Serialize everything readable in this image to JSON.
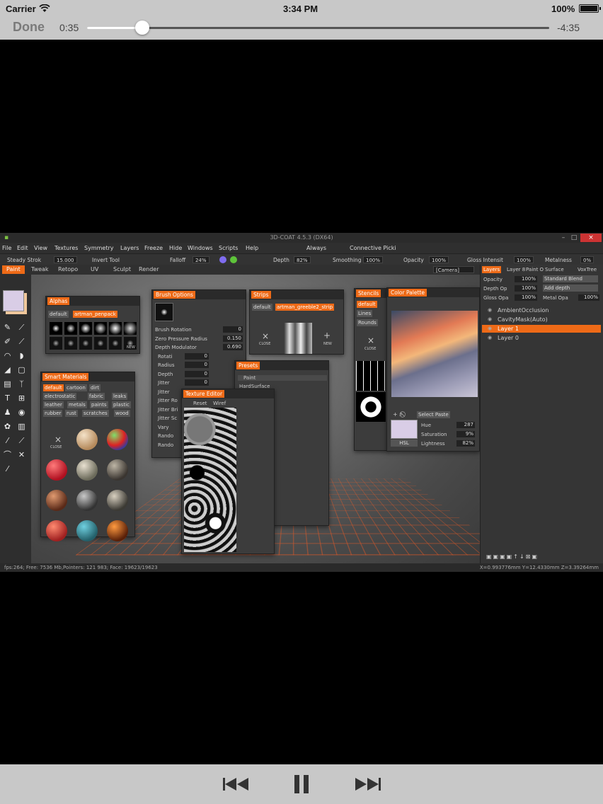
{
  "status_bar": {
    "carrier": "Carrier",
    "time": "3:34 PM",
    "battery": "100%"
  },
  "player": {
    "done_label": "Done",
    "elapsed": "0:35",
    "remaining": "-4:35",
    "progress_fraction": 0.12
  },
  "app": {
    "window_title": "3D-COAT 4.5.3 (DX64)",
    "menu": [
      "File",
      "Edit",
      "View",
      "Textures",
      "Symmetry",
      "Layers",
      "Freeze",
      "Hide",
      "Windows",
      "Scripts",
      "Help"
    ],
    "menu_extra": [
      "Always",
      "Connective Picki"
    ],
    "toolbar": {
      "steady_stroke": "Steady Strok",
      "steady_value": "15.000",
      "invert_tool": "Invert Tool",
      "falloff": "Falloff",
      "falloff_value": "24%",
      "depth": "Depth",
      "depth_value": "82%",
      "smoothing": "Smoothing",
      "smoothing_value": "100%",
      "opacity": "Opacity",
      "opacity_value": "100%",
      "gloss": "Gloss Intensit",
      "gloss_value": "100%",
      "metalness": "Metalness",
      "metalness_value": "0%"
    },
    "rooms": [
      "Paint",
      "Tweak",
      "Retopo",
      "UV",
      "Sculpt",
      "Render"
    ],
    "camera_label": "[Camera]",
    "alphas": {
      "title": "Alphas",
      "tabs": [
        "default",
        "artman_penpack"
      ],
      "new_label": "NEW"
    },
    "brush_options": {
      "title": "Brush Options",
      "rows": [
        {
          "label": "Brush Rotation",
          "value": "0"
        },
        {
          "label": "Zero Pressure Radius",
          "value": "0.150"
        },
        {
          "label": "Depth Modulator",
          "value": "0.690"
        },
        {
          "label": "Rotati",
          "value": "0"
        },
        {
          "label": "Radius",
          "value": "0"
        },
        {
          "label": "Depth",
          "value": "0"
        },
        {
          "label": "Jitter",
          "value": "0"
        },
        {
          "label": "Jitter",
          "value": ""
        },
        {
          "label": "Jitter Ro",
          "value": ""
        },
        {
          "label": "Jitter Bri",
          "value": ""
        },
        {
          "label": "Jitter Sc",
          "value": ""
        },
        {
          "label": "Vary",
          "value": ""
        },
        {
          "label": "Rando",
          "value": ""
        },
        {
          "label": "Rando",
          "value": ""
        }
      ]
    },
    "strips": {
      "title": "Strips",
      "tabs": [
        "default",
        "artman_greeble2_strip"
      ],
      "close_label": "CLOSE",
      "new_label": "NEW"
    },
    "stencils": {
      "title": "Stencils",
      "tabs": [
        "default"
      ],
      "buttons": [
        "Lines",
        "Rounds"
      ],
      "close_label": "CLOSE"
    },
    "presets": {
      "title": "Presets",
      "items": [
        "Paint",
        "HardSurface"
      ]
    },
    "texture_editor": {
      "title": "Texture Editor",
      "buttons": [
        "Reset",
        "Wiref"
      ]
    },
    "smart_materials": {
      "title": "Smart Materials",
      "tags": [
        "default",
        "cartoon",
        "dirt",
        "electrostatic",
        "fabric",
        "leaks",
        "leather",
        "metals",
        "paints",
        "plastic",
        "rubber",
        "rust",
        "scratches",
        "wood"
      ],
      "close_label": "CLOSE"
    },
    "color_palette": {
      "title": "Color Palette",
      "select_paste": "Select Paste",
      "hsl_label": "HSL",
      "hue_label": "Hue",
      "hue_value": "287",
      "saturation_label": "Saturation",
      "saturation_value": "9%",
      "lightness_label": "Lightness",
      "lightness_value": "82%",
      "current_color": "#d9cde6"
    },
    "layers": {
      "tabs": [
        "Layers",
        "Layer 8",
        "Paint O",
        "Surface",
        "VoxTree"
      ],
      "opacity_label": "Opacity",
      "opacity_value": "100%",
      "blend_mode": "Standard Blend",
      "depth_op_label": "Depth Op",
      "depth_op_value": "100%",
      "depth_mode": "Add depth",
      "gloss_op_label": "Gloss Opa",
      "gloss_op_value": "100%",
      "metal_op_label": "Metal Opa",
      "metal_op_value": "100%",
      "items": [
        "AmbientOcclusion",
        "CavityMask(Auto)",
        "Layer 1",
        "Layer 0"
      ],
      "selected_index": 2
    },
    "status": {
      "left": "fps:264;   Free: 7536 Mb,Pointers: 121 983;  Face: 19623/19623",
      "right": "X=0.993776mm  Y=12.4330mm  Z=3.39264mm"
    },
    "accent_color": "#ee6a17"
  },
  "controls": {
    "rewind": "skip-back-icon",
    "pause": "pause-icon",
    "forward": "skip-forward-icon"
  }
}
